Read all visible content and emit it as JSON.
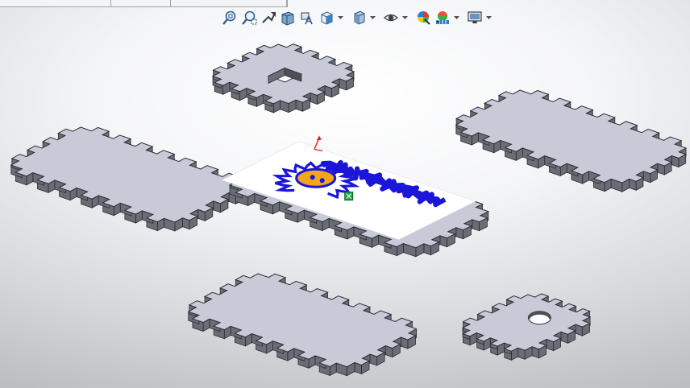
{
  "window": {
    "tab_segments": [
      "",
      "",
      ""
    ]
  },
  "toolbar": {
    "buttons": [
      {
        "icon": "zoom-to-fit-icon"
      },
      {
        "icon": "zoom-to-area-icon"
      },
      {
        "icon": "previous-view-icon"
      },
      {
        "icon": "section-view-icon"
      },
      {
        "icon": "dynamic-annotation-views-icon"
      },
      {
        "icon": "view-orientation-icon",
        "dropdown": true
      },
      {
        "icon": "display-style-icon",
        "dropdown": true
      },
      {
        "icon": "hide-show-items-icon",
        "dropdown": true
      },
      {
        "icon": "edit-appearance-icon"
      },
      {
        "icon": "apply-scene-icon",
        "dropdown": true
      },
      {
        "icon": "view-settings-icon",
        "dropdown": true
      }
    ]
  },
  "colors": {
    "face": "#c9cad8",
    "side": "#6a6c76",
    "side_dark": "#4d4f58",
    "edge": "#2c2d33",
    "decal_blue": "#1b16d8",
    "decal_orange": "#f2a51d",
    "axis_red": "#e01d1d",
    "handle_green": "#18a84a"
  },
  "parts": [
    {
      "id": "top-small-panel",
      "feature": "rectangular-cutout"
    },
    {
      "id": "left-long-panel",
      "feature": "none"
    },
    {
      "id": "center-panel",
      "feature": "decal"
    },
    {
      "id": "right-long-panel",
      "feature": "none"
    },
    {
      "id": "bottom-long-panel",
      "feature": "none"
    },
    {
      "id": "bottom-right-small-panel",
      "feature": "round-hole"
    }
  ]
}
